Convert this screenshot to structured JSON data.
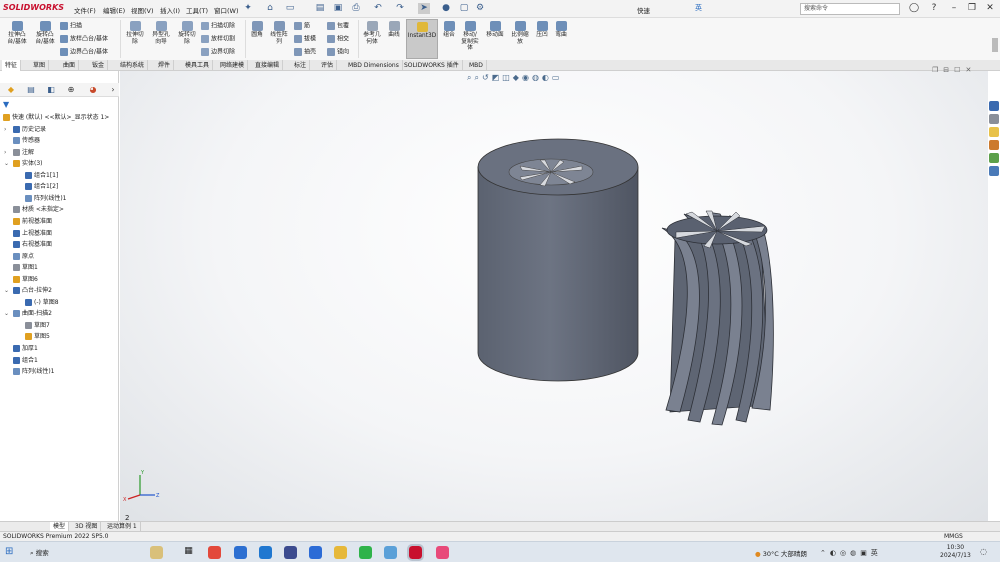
{
  "app": {
    "logo": "SOLIDWORKS",
    "menus": [
      "文件(F)",
      "编辑(E)",
      "视图(V)",
      "插入(I)",
      "工具(T)",
      "窗口(W)"
    ],
    "doc_name": "快速",
    "search_placeholder": "搜索命令",
    "ime": "英"
  },
  "ribbon": {
    "big_buttons": [
      {
        "label": "拉伸凸\n台/基体"
      },
      {
        "label": "旋转凸\n台/基体"
      },
      {
        "label": "拉伸切\n除"
      },
      {
        "label": "异型孔\n向导"
      },
      {
        "label": "旋转切\n除"
      },
      {
        "label": "圆角"
      },
      {
        "label": "线性阵\n列"
      },
      {
        "label": "参考几\n何体"
      },
      {
        "label": "曲线"
      },
      {
        "label": "Instant3D"
      },
      {
        "label": "组合"
      },
      {
        "label": "移动/\n复制实\n体"
      },
      {
        "label": "移动面"
      },
      {
        "label": "比例缩\n放"
      },
      {
        "label": "压凹"
      },
      {
        "label": "弯曲"
      }
    ],
    "small_buttons": {
      "sweep": "扫描",
      "loft": "放样凸台/基体",
      "boundary": "边界凸台/基体",
      "sweep_cut": "扫描切除",
      "loft_cut": "放样切割",
      "boundary_cut": "边界切除",
      "rib": "筋",
      "draft": "拔模",
      "shell": "抽壳",
      "wrap": "包覆",
      "intersect": "相交",
      "mirror": "镜向"
    }
  },
  "tabs": [
    "特征",
    "草图",
    "曲面",
    "钣金",
    "结构系统",
    "焊件",
    "模具工具",
    "网络建模",
    "直接编辑",
    "标注",
    "评估",
    "MBD Dimensions",
    "SOLIDWORKS 插件",
    "MBD"
  ],
  "tree": {
    "root": "快速 (默认) <<默认>_显示状态 1>",
    "items": [
      {
        "label": "历史记录",
        "indent": 1,
        "expand": "›"
      },
      {
        "label": "传感器",
        "indent": 1,
        "expand": ""
      },
      {
        "label": "注解",
        "indent": 1,
        "expand": "›"
      },
      {
        "label": "实体(3)",
        "indent": 1,
        "expand": "⌄"
      },
      {
        "label": "组合1[1]",
        "indent": 2,
        "expand": ""
      },
      {
        "label": "组合1[2]",
        "indent": 2,
        "expand": ""
      },
      {
        "label": "阵列(线性)1",
        "indent": 2,
        "expand": ""
      },
      {
        "label": "材质 <未指定>",
        "indent": 1,
        "expand": ""
      },
      {
        "label": "前视基准面",
        "indent": 1,
        "expand": ""
      },
      {
        "label": "上视基准面",
        "indent": 1,
        "expand": ""
      },
      {
        "label": "右视基准面",
        "indent": 1,
        "expand": ""
      },
      {
        "label": "原点",
        "indent": 1,
        "expand": ""
      },
      {
        "label": "草图1",
        "indent": 1,
        "expand": ""
      },
      {
        "label": "草图6",
        "indent": 1,
        "expand": ""
      },
      {
        "label": "凸台-拉伸2",
        "indent": 1,
        "expand": "⌄"
      },
      {
        "label": "(-) 草图8",
        "indent": 2,
        "expand": ""
      },
      {
        "label": "曲面-扫描2",
        "indent": 1,
        "expand": "⌄"
      },
      {
        "label": "草图7",
        "indent": 2,
        "expand": ""
      },
      {
        "label": "草图5",
        "indent": 2,
        "expand": ""
      },
      {
        "label": "加厚1",
        "indent": 1,
        "expand": ""
      },
      {
        "label": "组合1",
        "indent": 1,
        "expand": ""
      },
      {
        "label": "阵列(线性)1",
        "indent": 1,
        "expand": ""
      }
    ]
  },
  "viewport": {
    "axis_x": "X",
    "axis_y": "Y",
    "axis_z": "Z",
    "corner_label": "2"
  },
  "bottom_tabs": [
    "模型",
    "3D 视图",
    "运动算例 1"
  ],
  "status": {
    "text": "SOLIDWORKS Premium 2022 SP5.0",
    "units": "MMGS"
  },
  "taskbar": {
    "search": "搜索",
    "weather": "30°C  大部晴朗",
    "time": "10:30",
    "date": "2024/7/13"
  },
  "colors": {
    "brand": "#c8102e",
    "part": "#5f6775"
  }
}
